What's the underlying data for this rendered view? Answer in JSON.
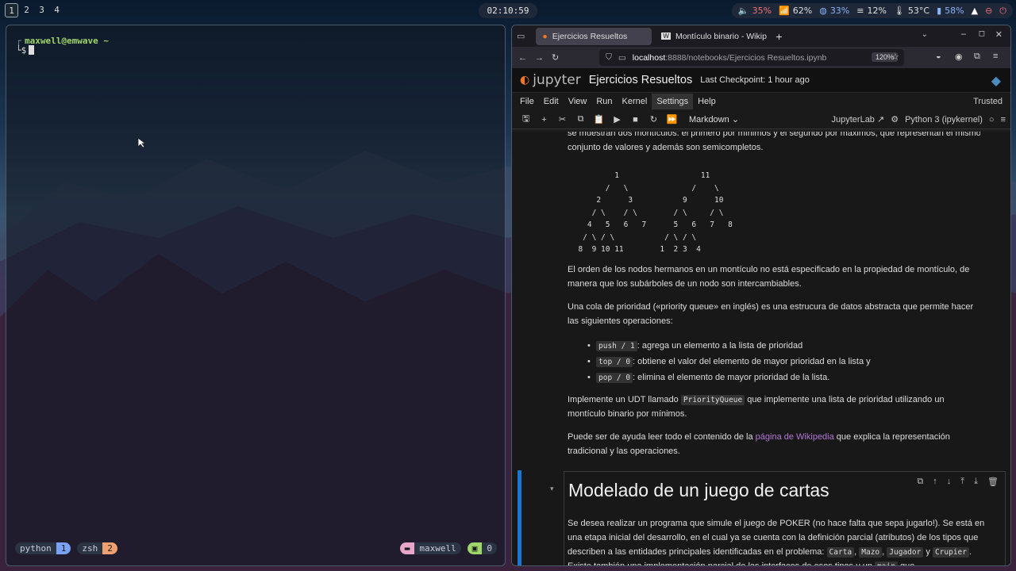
{
  "topbar": {
    "workspaces": [
      "1",
      "2",
      "3",
      "4"
    ],
    "clock": "02:10:59",
    "status": {
      "volume": "35%",
      "wifi": "62%",
      "disk": "33%",
      "memory": "12%",
      "temp": "53°C",
      "battery": "58%"
    }
  },
  "terminal": {
    "prompt_user": "maxwell@emwave ~",
    "prompt_symbol": "$",
    "badges": [
      {
        "name": "python",
        "count": "1",
        "color": "#7aa2f7"
      },
      {
        "name": "zsh",
        "count": "2",
        "color": "#f0a070"
      }
    ],
    "right_badges": [
      {
        "name": "maxwell",
        "color": "#e8a6c8"
      },
      {
        "name": "0",
        "color": "#9fd66a"
      }
    ]
  },
  "browser": {
    "tabs": [
      {
        "title": "Ejercicios Resueltos",
        "active": true
      },
      {
        "title": "Montículo binario - Wikip",
        "active": false
      }
    ],
    "url_host": "localhost",
    "url_path": ":8888/notebooks/Ejercicios Resueltos.ipynb",
    "zoom": "120%"
  },
  "jupyter": {
    "logo_text": "jupyter",
    "notebook_title": "Ejercicios Resueltos",
    "checkpoint": "Last Checkpoint: 1 hour ago",
    "menu": [
      "File",
      "Edit",
      "View",
      "Run",
      "Kernel",
      "Settings",
      "Help"
    ],
    "active_menu": "Settings",
    "trusted": "Trusted",
    "cell_type": "Markdown",
    "jupyterlab_link": "JupyterLab",
    "kernel": "Python 3 (ipykernel)"
  },
  "notebook": {
    "partial_top": "se muestran dos montículos: el primero por mínimos y el segundo por máximos, que representan el mismo",
    "p_intro_tail": "conjunto de valores y además son semicompletos.",
    "ascii_tree": "          1                  11\n        /   \\              /    \\\n      2      3           9      10\n     / \\    / \\        / \\     / \\\n    4   5   6   7      5   6   7   8\n   / \\ / \\           / \\ / \\\n  8  9 10 11        1  2 3  4",
    "p_order": "El orden de los nodos hermanos en un montículo no está especificado en la propiedad de montículo, de manera que los subárboles de un nodo son intercambiables.",
    "p_queue": "Una cola de prioridad («priority queue» en inglés) es una estrucura de datos abstracta que permite hacer las siguientes operaciones:",
    "ops": [
      {
        "code": "push / 1",
        "text": ": agrega un elemento a la lista de prioridad"
      },
      {
        "code": "top / 0",
        "text": ": obtiene el valor del elemento de mayor prioridad en la lista y"
      },
      {
        "code": "pop / 0",
        "text": ": elimina el elemento de mayor prioridad de la lista."
      }
    ],
    "p_impl_a": "Implemente un UDT llamado ",
    "p_impl_code": "PriorityQueue",
    "p_impl_b": " que implemente una lista de prioridad utilizando un montículo binario por mínimos.",
    "p_help_a": "Puede ser de ayuda leer todo el contenido de la ",
    "p_help_link": "página de Wikipedia",
    "p_help_b": " que explica la representación tradicional y las operaciones.",
    "h1": "Modelado de un juego de cartas",
    "p_poker_a": "Se desea realizar un programa que simule el juego de POKER (no hace falta que sepa jugarlo!). Se está en una etapa inicial del desarrollo, en el cual ya se cuenta con la definición parcial (atributos) de los tipos que describen a las entidades principales identificadas en el problema: ",
    "codes_poker": [
      "Carta",
      "Mazo",
      "Jugador",
      "Crupier"
    ],
    "p_poker_tail": ". Existe también una implementación parcial de las interfaces de esos tipos y un",
    "p_poker_main": "main",
    "p_poker_end": " que"
  }
}
